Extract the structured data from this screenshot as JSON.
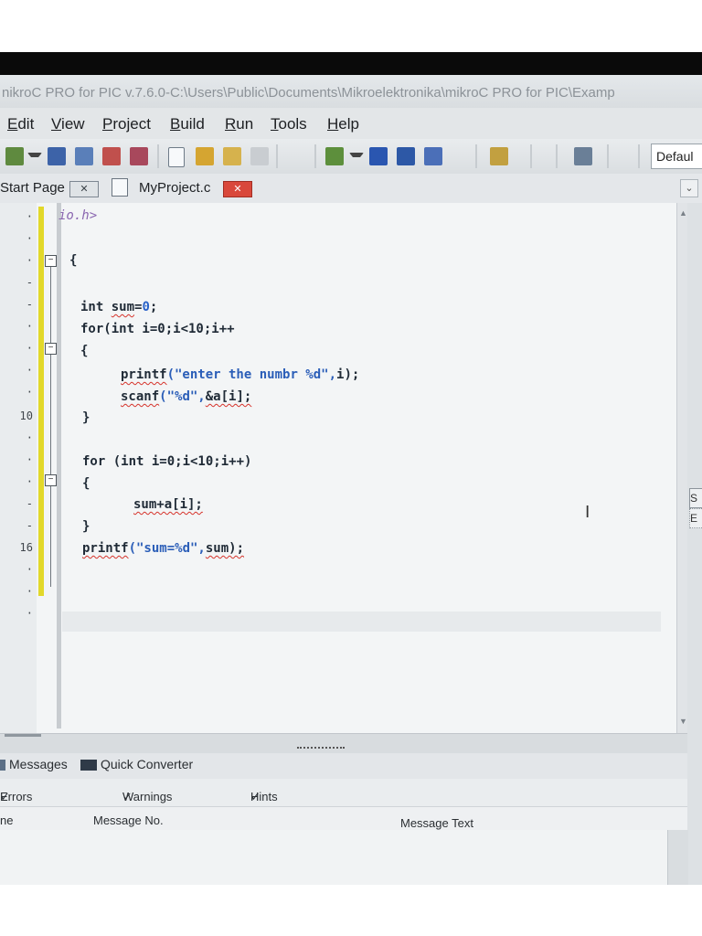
{
  "window": {
    "title": "nikroC PRO for PIC v.7.6.0-C:\\Users\\Public\\Documents\\Mikroelektronika\\mikroC PRO for PIC\\Examp"
  },
  "menu": {
    "items": [
      "Edit",
      "View",
      "Project",
      "Build",
      "Run",
      "Tools",
      "Help"
    ]
  },
  "toolbar": {
    "combo_value": "Defaul",
    "icons": [
      "new-file-icon",
      "save-icon",
      "open-icon",
      "build-icon",
      "run-icon",
      "project-icon"
    ]
  },
  "tabs": {
    "start_page": "Start Page",
    "project_file": "MyProject.c",
    "close_glyph": "✕"
  },
  "editor": {
    "line_numbers": {
      "l10": "10",
      "l16": "16"
    },
    "lines": {
      "line1": "io.h>",
      "line3": "{",
      "line5_a": "int ",
      "line5_b": "sum",
      "line5_c": "=",
      "line5_d": "0",
      "line5_e": ";",
      "line6": "for(int i=0;i<10;i++",
      "line7": "{",
      "line8_fn": "printf",
      "line8_str": "(\"enter the numbr %d\",",
      "line8_rest": "i);",
      "line9_fn": "scanf",
      "line9_str": "(\"%d\",",
      "line9_rest": "&a[i];",
      "line10": "}",
      "line12": "for (int i=0;i<10;i++)",
      "line13": "{",
      "line14": "sum+a[i];",
      "line15": "}",
      "line16_fn": "printf",
      "line16_str": "(\"sum=%d\",",
      "line16_rest": "sum);"
    }
  },
  "right_tabs": {
    "s": "S",
    "e": "E"
  },
  "messages": {
    "tab_messages": "Messages",
    "tab_quick_converter": "Quick Converter",
    "filter_errors": "Errors",
    "filter_warnings": "Warnings",
    "filter_hints": "Hints",
    "col_line": "ne",
    "col_message_no": "Message No.",
    "col_message_text": "Message Text"
  }
}
